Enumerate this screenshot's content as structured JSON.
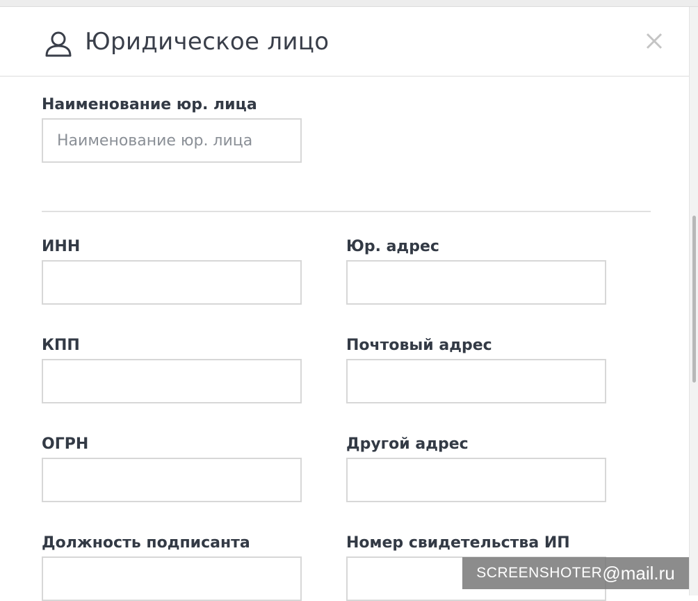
{
  "dialog": {
    "title": "Юридическое лицо",
    "close_label": "×"
  },
  "company": {
    "name_label": "Наименование юр. лица",
    "name_placeholder": "Наименование юр. лица",
    "name_value": ""
  },
  "fields": {
    "inn_label": "ИНН",
    "legal_address_label": "Юр. адрес",
    "kpp_label": "КПП",
    "postal_address_label": "Почтовый адрес",
    "ogrn_label": "ОГРН",
    "other_address_label": "Другой адрес",
    "signatory_position_label": "Должность подписанта",
    "ip_certificate_label": "Номер свидетельства ИП"
  },
  "watermark": {
    "part1": "SCREENSHOTER",
    "part2": "@mail.ru"
  },
  "colors": {
    "text": "#333a45",
    "border": "#d7d7d7",
    "divider": "#e0e0e0",
    "watermark_bg": "#787878"
  },
  "icons": {
    "header": "user-icon",
    "close": "close-icon"
  }
}
